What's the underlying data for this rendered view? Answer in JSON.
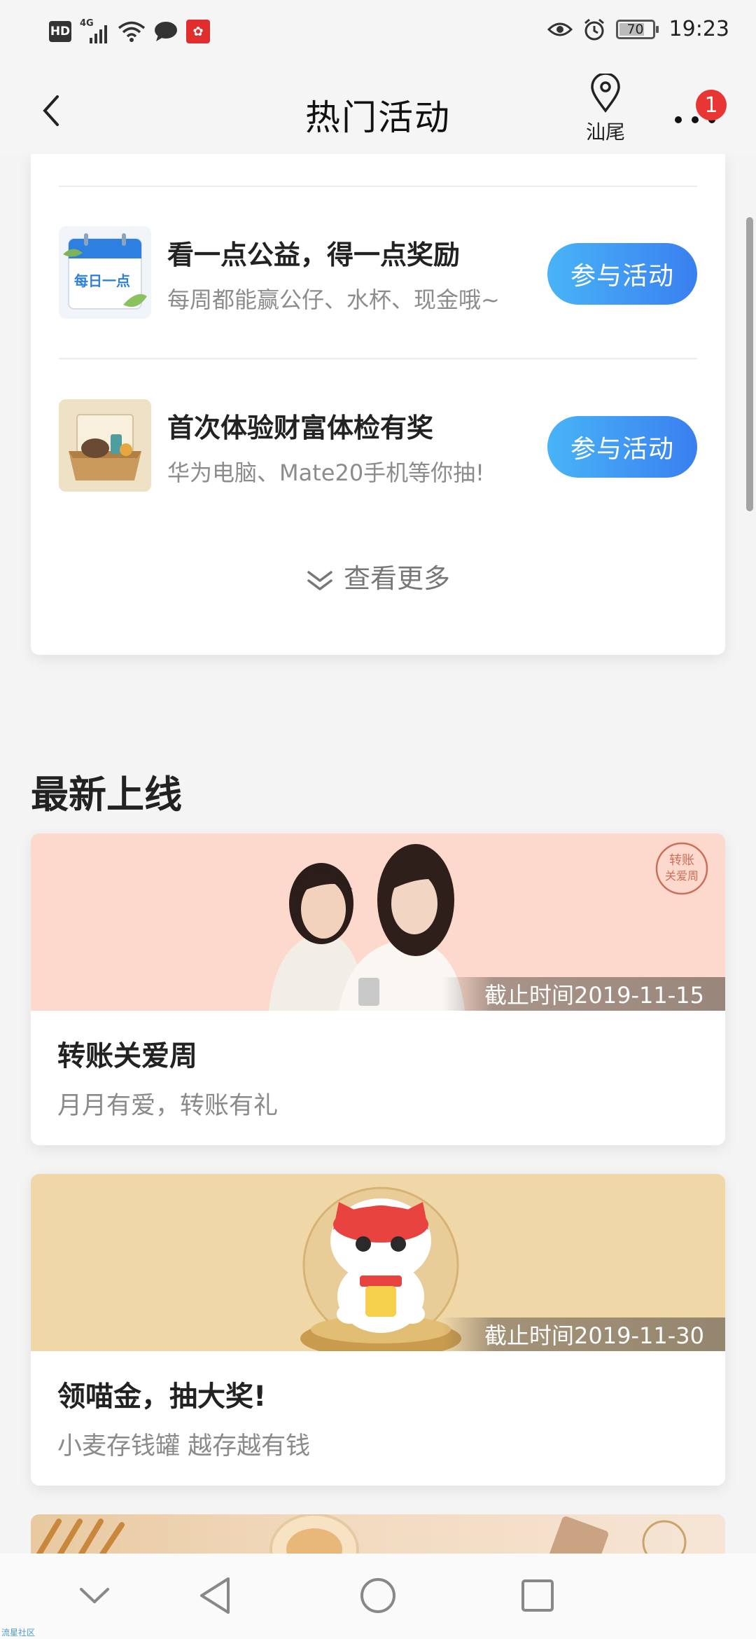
{
  "status_bar": {
    "hd": "HD",
    "network": "4G",
    "battery": "70",
    "time": "19:23"
  },
  "header": {
    "title": "热门活动",
    "location": "汕尾",
    "badge_count": "1"
  },
  "activities": [
    {
      "title": "看一点公益，得一点奖励",
      "subtitle": "每周都能赢公仔、水杯、现金哦~",
      "button": "参与活动",
      "thumb_text": "每日一点"
    },
    {
      "title": "首次体验财富体检有奖",
      "subtitle": "华为电脑、Mate20手机等你抽!",
      "button": "参与活动"
    }
  ],
  "see_more": "查看更多",
  "section_title": "最新上线",
  "promos": [
    {
      "deadline": "截止时间2019-11-15",
      "title": "转账关爱周",
      "subtitle": "月月有爱，转账有礼",
      "stamp_line1": "转账",
      "stamp_line2": "关爱周",
      "banner_color": "#fcd9cc"
    },
    {
      "deadline": "截止时间2019-11-30",
      "title": "领喵金，抽大奖!",
      "subtitle": "小麦存钱罐 越存越有钱",
      "banner_color": "#f0d7a8"
    }
  ],
  "watermark": "流星社区"
}
